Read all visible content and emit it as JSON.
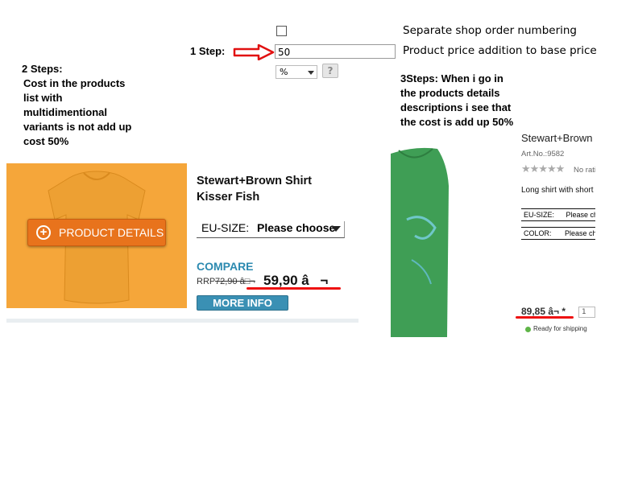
{
  "annotations": {
    "step1": "1 Step:",
    "step2_lines": [
      "2 Steps:",
      "Cost in the products",
      "list with",
      "multidimentional",
      "variants is not add up",
      "cost 50%"
    ],
    "step3_lines": [
      "3Steps: When i go in",
      "the products details",
      "descriptions i see that",
      "the cost is add up 50%"
    ]
  },
  "settings": {
    "separate_numbering_label": "Separate shop order numbering",
    "separate_numbering_checked": false,
    "price_addition_label": "Product price addition to base price",
    "price_addition_value": "50",
    "unit_select_value": "%",
    "help_symbol": "?"
  },
  "product_card": {
    "details_button": "PRODUCT DETAILS",
    "plus_symbol": "+",
    "title_line1": "Stewart+Brown Shirt",
    "title_line2": "Kisser Fish",
    "size_label": "EU-SIZE:",
    "size_value": "Please choose",
    "compare_label": "COMPARE",
    "rrp_label": "RRP",
    "rrp_value": "72,90 â□¬",
    "price": "59,90 â¬",
    "more_info_button": "MORE INFO",
    "image_color": "#f5a63a"
  },
  "detail_page": {
    "title": "Stewart+Brown S",
    "article_no": "Art.No.:9582",
    "rating_text": "No ratir",
    "description": "Long shirt with short s",
    "size_label": "EU-SIZE:",
    "size_value": "Please choo",
    "color_label": "COLOR:",
    "color_value": "Please choo",
    "price": "89,85 â¬ *",
    "qty": "1",
    "shipping": "Ready for shipping",
    "shirt_color": "#3f9e55",
    "shipping_dot_color": "#5fb548"
  },
  "colors": {
    "highlight_red": "#e11111",
    "arrow_red": "#e11111"
  }
}
